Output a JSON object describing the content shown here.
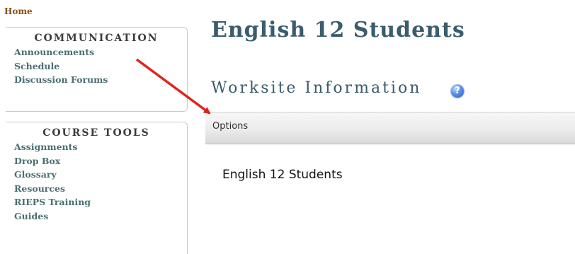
{
  "home": {
    "label": "Home"
  },
  "nav": {
    "communication": {
      "heading": "COMMUNICATION",
      "items": [
        "Announcements",
        "Schedule",
        "Discussion Forums"
      ]
    },
    "course_tools": {
      "heading": "COURSE TOOLS",
      "items": [
        "Assignments",
        "Drop Box",
        "Glossary",
        "Resources",
        "RIEPS Training",
        "Guides"
      ]
    }
  },
  "main": {
    "site_title": "English 12 Students",
    "tool_title": "Worksite Information",
    "help_icon": "question-mark-icon",
    "options_label": "Options",
    "site_description": "English 12 Students"
  },
  "annotation": {
    "arrow_color": "#e0241b"
  },
  "colors": {
    "title": "#3a5c6c",
    "nav_link": "#4a6e72",
    "home_link": "#8a4d16",
    "help_icon": "#4a7fdc"
  }
}
